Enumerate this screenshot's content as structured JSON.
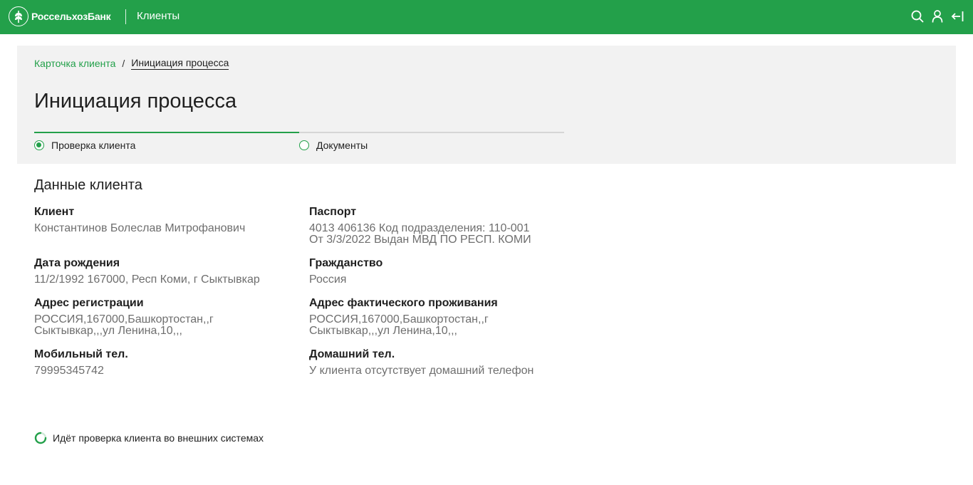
{
  "header": {
    "logo_text": "РоссельхозБанк",
    "nav_title": "Клиенты",
    "icons": [
      "search-icon",
      "user-icon",
      "logout-icon"
    ],
    "accent_color": "#23a04a"
  },
  "breadcrumb": {
    "parent": "Карточка клиента",
    "separator": "/",
    "current": "Инициация процесса"
  },
  "page": {
    "title": "Инициация процесса"
  },
  "stepper": {
    "steps": [
      {
        "label": "Проверка клиента",
        "state": "active"
      },
      {
        "label": "Документы",
        "state": "inactive"
      }
    ]
  },
  "client_data": {
    "title": "Данные клиента",
    "fields": {
      "client": {
        "label": "Клиент",
        "value": "Константинов Болеслав Митрофанович"
      },
      "passport": {
        "label": "Паспорт",
        "value": "4013 406136 Код подразделения: 110-001\nОт 3/3/2022 Выдан МВД ПО РЕСП. КОМИ"
      },
      "birth": {
        "label": "Дата рождения",
        "value": "11/2/1992 167000, Респ Коми, г Сыктывкар"
      },
      "citizenship": {
        "label": "Гражданство",
        "value": "Россия"
      },
      "reg_address": {
        "label": "Адрес регистрации",
        "value": "РОССИЯ,167000,Башкортостан,,г\nСыктывкар,,,ул Ленина,10,,,"
      },
      "actual_address": {
        "label": "Адрес фактического проживания",
        "value": "РОССИЯ,167000,Башкортостан,,г\nСыктывкар,,,ул Ленина,10,,,"
      },
      "mobile": {
        "label": "Мобильный тел.",
        "value": "79995345742"
      },
      "home_phone": {
        "label": "Домашний тел.",
        "value": "У клиента отсутствует домашний телефон"
      }
    }
  },
  "status": {
    "text": "Идёт проверка клиента во внешних системах"
  }
}
